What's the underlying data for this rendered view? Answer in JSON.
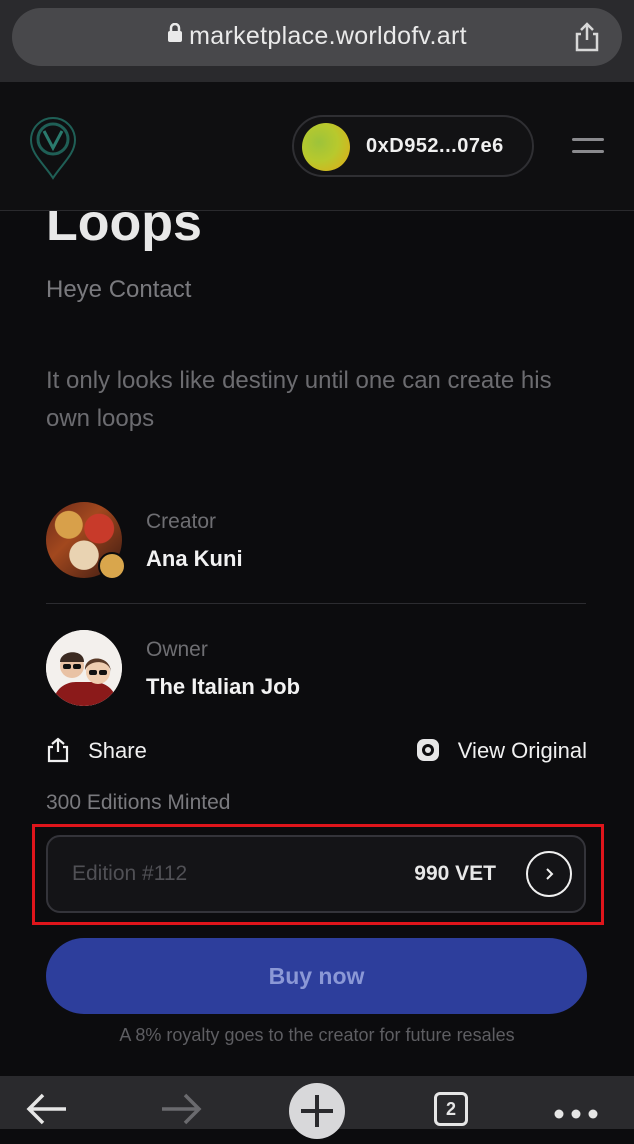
{
  "browser": {
    "url": "marketplace.worldofv.art",
    "tabs_count": "2"
  },
  "header": {
    "wallet_address": "0xD952...07e6"
  },
  "artwork": {
    "title": "Loops",
    "collection": "Heye Contact",
    "description": "It only looks like destiny until one can create his own loops"
  },
  "creator": {
    "label": "Creator",
    "name": "Ana Kuni"
  },
  "owner": {
    "label": "Owner",
    "name": "The Italian Job"
  },
  "actions": {
    "share_label": "Share",
    "view_original_label": "View Original"
  },
  "editions_minted": "300 Editions Minted",
  "edition_select": {
    "placeholder": "Edition #112",
    "price": "990 VET"
  },
  "buy_button_label": "Buy now",
  "royalty_note": "A 8% royalty goes to the creator for future resales",
  "colors": {
    "accent": "#2d3e9c",
    "highlight": "#e0151b"
  }
}
